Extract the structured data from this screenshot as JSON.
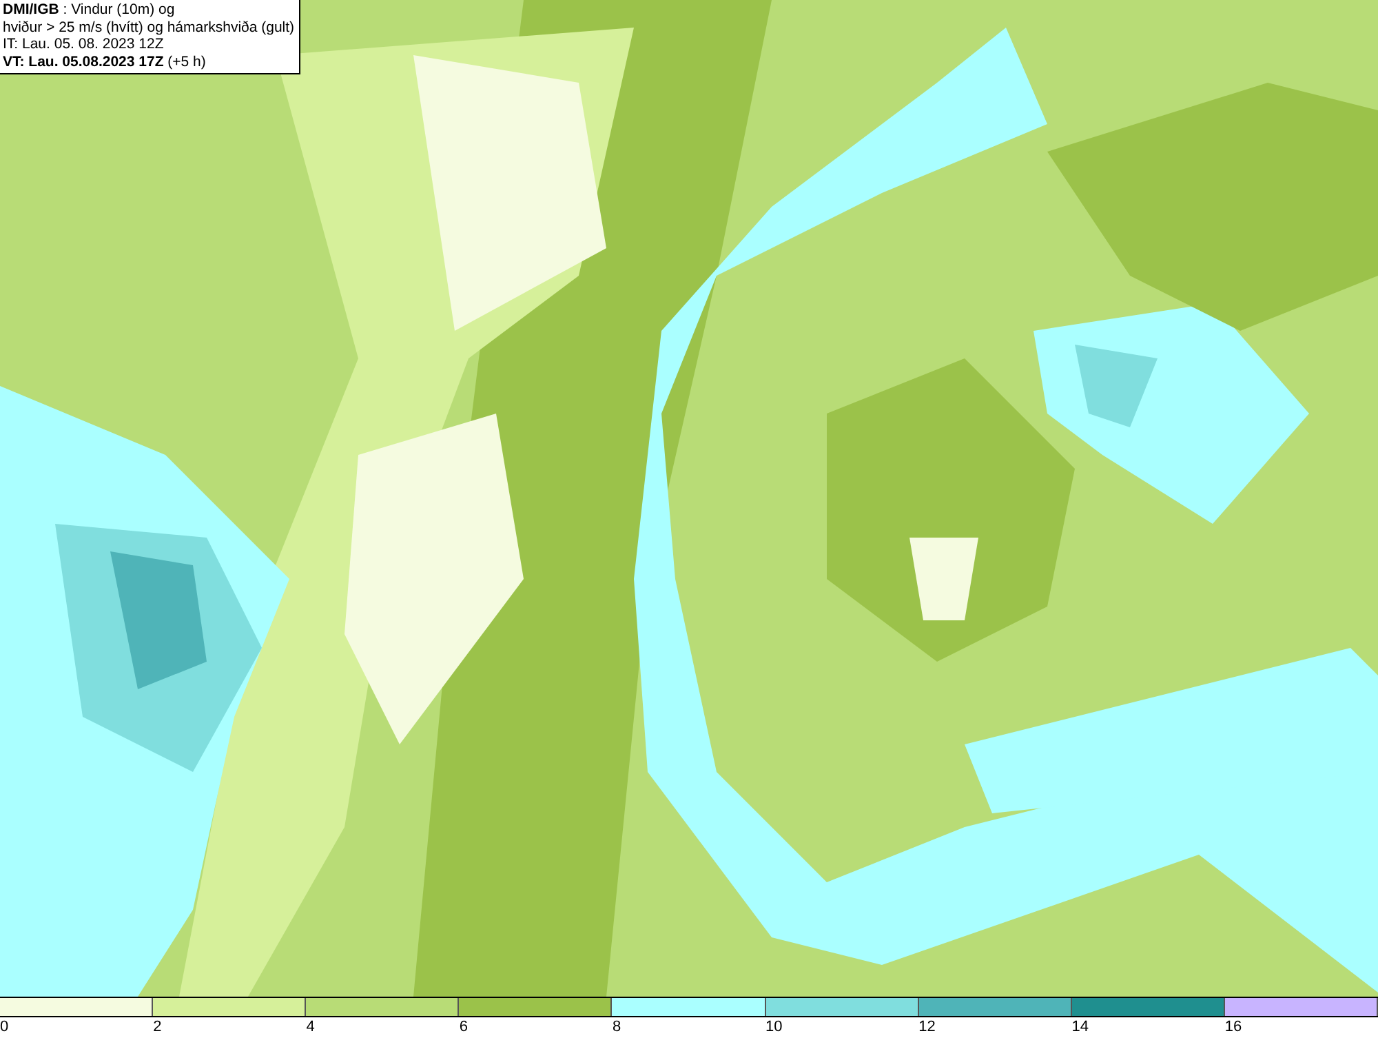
{
  "title_box": {
    "lines": [
      "**DMI/IGB** : Vindur (10m) og",
      "hviður > 25 m/s (hvítt) og hámarkshviða (gult)",
      "IT: Lau. 05. 08. 2023 12Z",
      "**VT: Lau. 05.08.2023 17Z** (+5 h)"
    ]
  },
  "legend": [
    {
      "label": "0",
      "color": "#f5fbe0"
    },
    {
      "label": "2",
      "color": "#d6f09a"
    },
    {
      "label": "4",
      "color": "#b8dc76"
    },
    {
      "label": "6",
      "color": "#9bc24a"
    },
    {
      "label": "8",
      "color": "#aaffff"
    },
    {
      "label": "10",
      "color": "#80dede"
    },
    {
      "label": "12",
      "color": "#4fb4b8"
    },
    {
      "label": "14",
      "color": "#1f8f8f"
    },
    {
      "label": "16",
      "color": "#c8b4ff"
    }
  ]
}
